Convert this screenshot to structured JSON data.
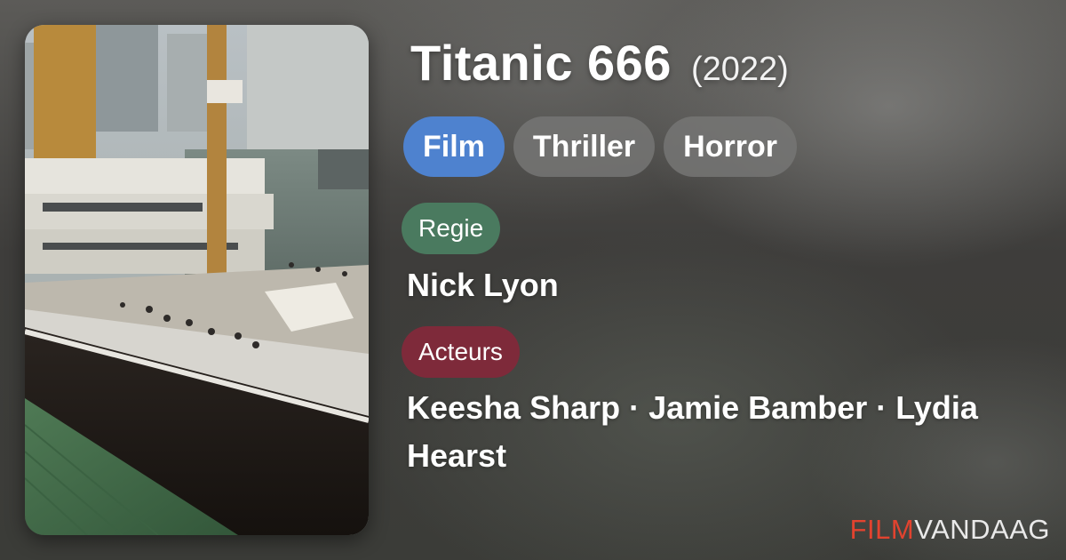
{
  "movie": {
    "title": "Titanic 666",
    "year": "(2022)",
    "poster_icon": "ship-poster-image"
  },
  "genres": [
    "Film",
    "Thriller",
    "Horror"
  ],
  "director": {
    "label": "Regie",
    "value": "Nick Lyon"
  },
  "cast": {
    "label": "Acteurs",
    "value": "Keesha Sharp · Jamie Bamber · Lydia Hearst"
  },
  "brand": {
    "part1": "FILM",
    "part2": "VANDAAG"
  },
  "colors": {
    "genre_primary": "#4e82cf",
    "genre_muted": "#767674",
    "regie_label": "#4a7a5f",
    "acteurs_label": "#7e2a3a",
    "brand_accent": "#e2432f"
  }
}
